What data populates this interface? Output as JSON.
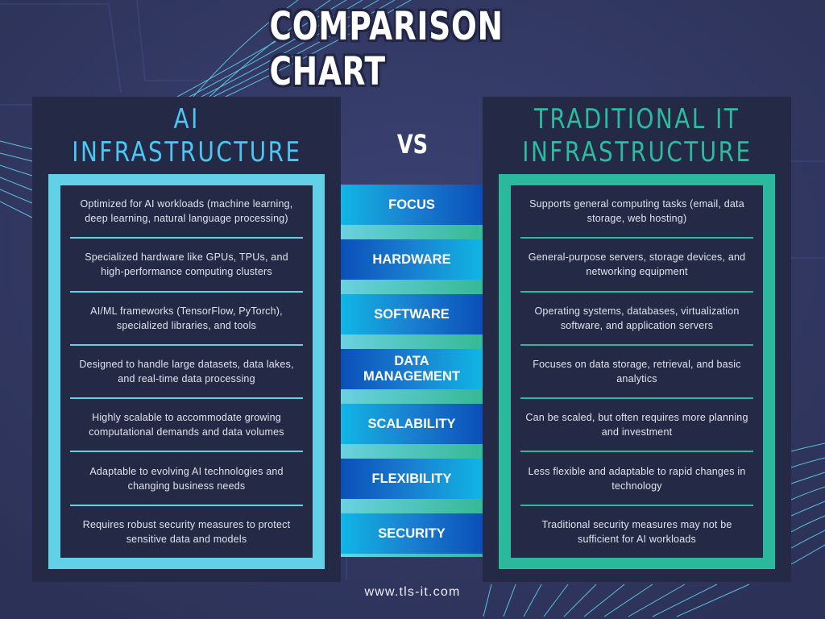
{
  "title": "COMPARISON CHART",
  "vs_label": "VS",
  "colors": {
    "background": "#323861",
    "panel": "#242a46",
    "ai_accent": "#62d0e6",
    "ai_title": "#4cc6f2",
    "traditional_accent": "#2ab99d",
    "category_blue": "#0a4fb8",
    "category_cyan": "#10b6e4"
  },
  "left_panel": {
    "title_line1": "AI",
    "title_line2": "INFRASTRUCTURE",
    "items": [
      "Optimized for AI workloads (machine learning, deep learning, natural language processing)",
      "Specialized hardware like GPUs, TPUs, and high-performance computing clusters",
      "AI/ML frameworks (TensorFlow, PyTorch), specialized libraries, and tools",
      "Designed to handle large datasets, data lakes, and real-time data processing",
      "Highly scalable to accommodate growing computational demands and data volumes",
      "Adaptable to evolving AI technologies and changing business needs",
      "Requires robust security measures to protect sensitive data and models"
    ]
  },
  "categories": [
    "FOCUS",
    "HARDWARE",
    "SOFTWARE",
    "DATA MANAGEMENT",
    "SCALABILITY",
    "FLEXIBILITY",
    "SECURITY"
  ],
  "right_panel": {
    "title_line1": "TRADITIONAL IT",
    "title_line2": "INFRASTRUCTURE",
    "items": [
      "Supports general computing tasks (email, data storage, web hosting)",
      "General-purpose servers, storage devices, and networking equipment",
      "Operating systems, databases, virtualization software, and application servers",
      "Focuses on data storage, retrieval, and basic analytics",
      "Can be scaled, but often requires more planning and investment",
      "Less flexible and adaptable to rapid changes in technology",
      "Traditional security measures may not be sufficient for AI workloads"
    ]
  },
  "footer": {
    "website": "www.tls-it.com"
  }
}
